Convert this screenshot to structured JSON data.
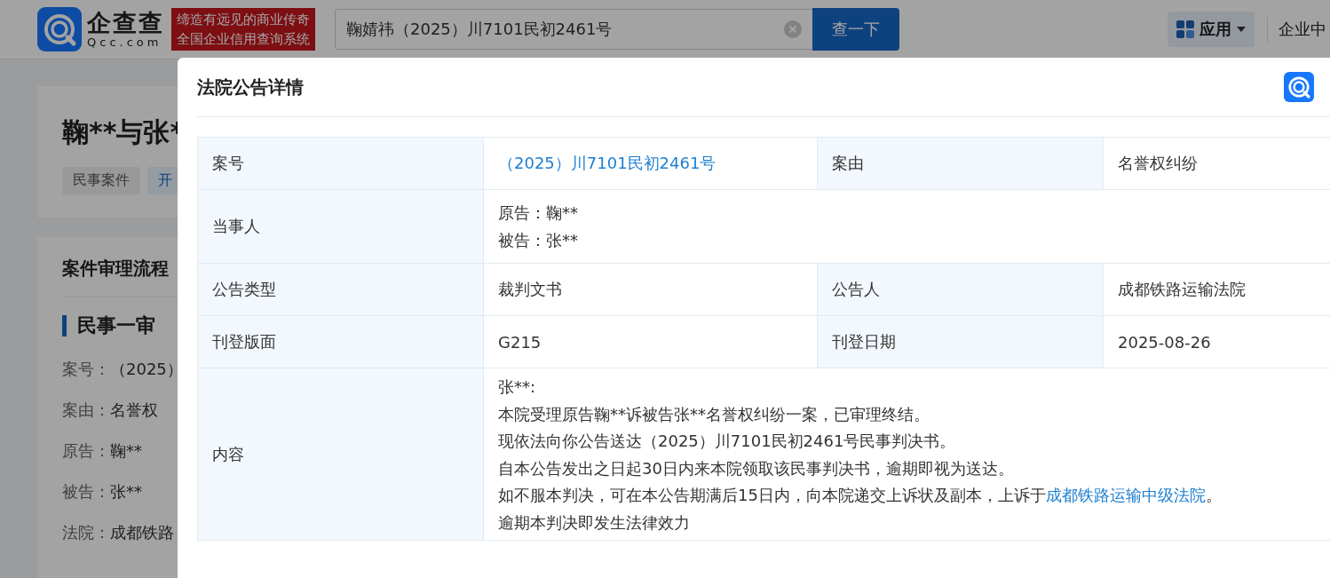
{
  "header": {
    "logo_text": "企查查",
    "logo_domain": "Qcc.com",
    "slogan": [
      "缔造有远见的商业传奇",
      "全国企业信用查询系统"
    ],
    "search": {
      "value": "鞠婧祎（2025）川7101民初2461号"
    },
    "search_button": "查一下",
    "apps_menu": "应用",
    "user_center": "企业中"
  },
  "case_card": {
    "title": "鞠**与张*",
    "tags": [
      "民事案件",
      "开"
    ]
  },
  "process_card": {
    "title": "案件审理流程",
    "stage": "民事一审",
    "fields": [
      {
        "label": "案号：",
        "value": "（2025）"
      },
      {
        "label": "案由：",
        "value": "名誉权"
      },
      {
        "label": "原告：",
        "value": "鞠**"
      },
      {
        "label": "被告：",
        "value": "张**"
      },
      {
        "label": "法院：",
        "value": "成都铁路"
      }
    ]
  },
  "dialog": {
    "title": "法院公告详情",
    "rows": [
      {
        "kind": "pair",
        "cells": [
          {
            "label": "案号",
            "value": "（2025）川7101民初2461号",
            "kind": "link"
          },
          {
            "label": "案由",
            "value": "名誉权纠纷",
            "kind": "text"
          }
        ]
      },
      {
        "kind": "lines",
        "label": "当事人",
        "lines": [
          "原告：鞠**",
          "被告：张**"
        ]
      },
      {
        "kind": "pair",
        "cells": [
          {
            "label": "公告类型",
            "value": "裁判文书",
            "kind": "text"
          },
          {
            "label": "公告人",
            "value": "成都铁路运输法院",
            "kind": "text"
          }
        ]
      },
      {
        "kind": "pair",
        "cells": [
          {
            "label": "刊登版面",
            "value": "G215",
            "kind": "text"
          },
          {
            "label": "刊登日期",
            "value": "2025-08-26",
            "kind": "text"
          }
        ]
      },
      {
        "kind": "content",
        "label": "内容",
        "lines": [
          {
            "text": "张**:"
          },
          {
            "text": "本院受理原告鞠**诉被告张**名誉权纠纷一案，已审理终结。"
          },
          {
            "text": "现依法向你公告送达（2025）川7101民初2461号民事判决书。"
          },
          {
            "text": "自本公告发出之日起30日内来本院领取该民事判决书，逾期即视为送达。"
          },
          {
            "text": "如不服本判决，可在本公告期满后15日内，向本院递交上诉状及副本，上诉于",
            "link": "成都铁路运输中级法院",
            "after": "。"
          },
          {
            "text": "逾期本判决即发生法律效力"
          }
        ]
      }
    ]
  }
}
